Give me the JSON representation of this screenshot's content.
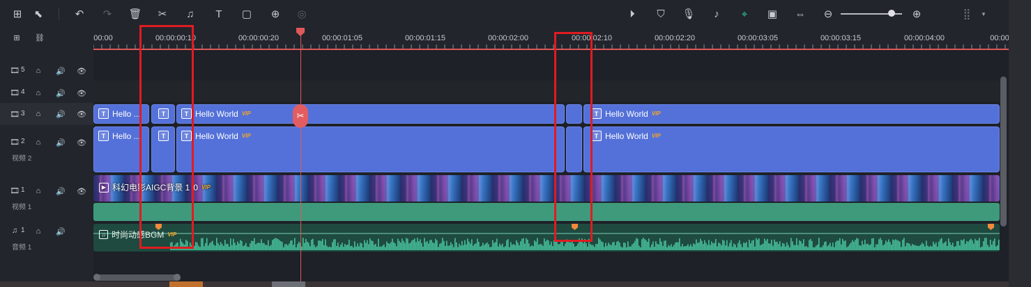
{
  "ruler": {
    "ticks": [
      "00:00",
      "00:00:00:10",
      "00:00:00:20",
      "00:00:01:05",
      "00:00:01:15",
      "00:00:02:00",
      "00:00:02:10",
      "00:00:02:20",
      "00:00:03:05",
      "00:00:03:15",
      "00:00:04:00",
      "00:00"
    ]
  },
  "tracks": {
    "t5": {
      "num": "5"
    },
    "t4": {
      "num": "4"
    },
    "t3": {
      "num": "3"
    },
    "t2": {
      "num": "2",
      "label": "视频 2"
    },
    "t1": {
      "num": "1",
      "label": "视频 1"
    },
    "a1": {
      "num": "1",
      "label": "音频 1"
    }
  },
  "clips": {
    "text_t": "T",
    "hello_short": "Hello ...",
    "hello": "Hello World",
    "vip": "VIP",
    "video_title": "科幻电影AIGC背景 1",
    "video_suffix": "0",
    "audio_title": "时尚动感BGM"
  },
  "colors": {
    "accent": "#2ed3a3",
    "playhead": "#e0585a",
    "text_clip": "#5471d9",
    "highlight": "#e11b22",
    "audio": "#3f9a7c"
  }
}
